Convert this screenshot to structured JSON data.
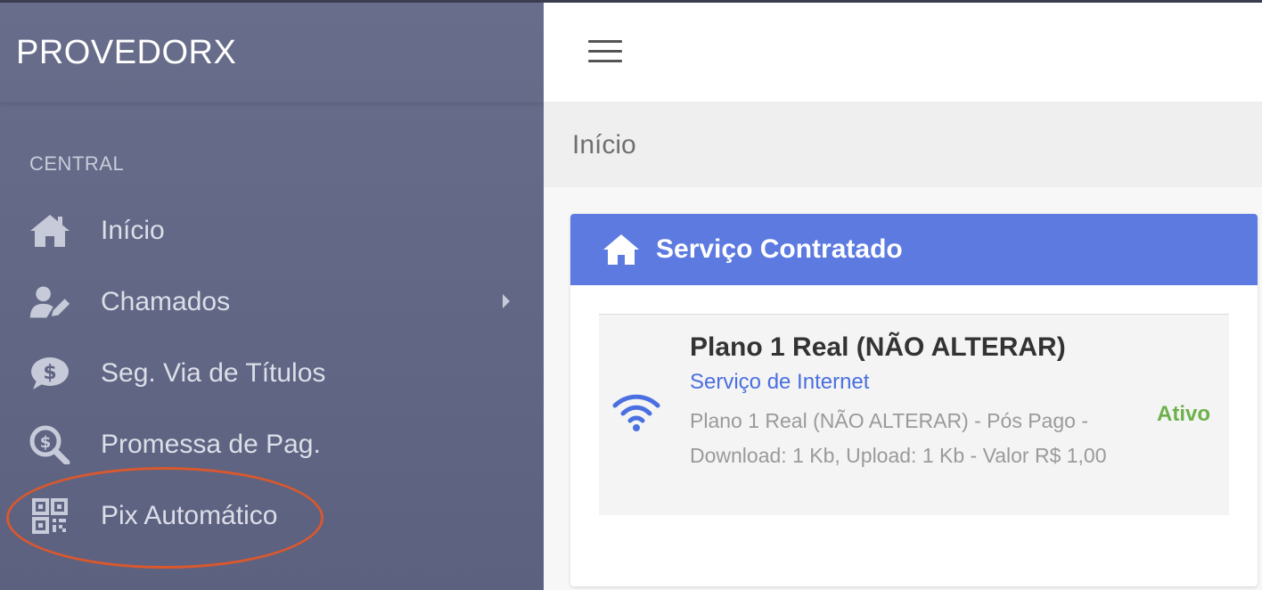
{
  "sidebar": {
    "brand": "PROVEDORX",
    "section_label": "CENTRAL",
    "items": [
      {
        "label": "Início",
        "icon": "home-icon"
      },
      {
        "label": "Chamados",
        "icon": "user-edit-icon",
        "has_submenu": true
      },
      {
        "label": "Seg. Via de Títulos",
        "icon": "money-chat-icon"
      },
      {
        "label": "Promessa de Pag.",
        "icon": "search-dollar-icon"
      },
      {
        "label": "Pix Automático",
        "icon": "qrcode-icon",
        "highlighted": true
      }
    ]
  },
  "topbar": {
    "menu_icon": "hamburger-icon"
  },
  "breadcrumb": {
    "current": "Início"
  },
  "card": {
    "title": "Serviço Contratado",
    "icon": "home-icon",
    "service": {
      "name": "Plano 1 Real (NÃO ALTERAR)",
      "type": "Serviço de Internet",
      "description": "Plano 1 Real (NÃO ALTERAR) - Pós Pago - Download: 1 Kb, Upload: 1 Kb - Valor R$ 1,00",
      "status": "Ativo",
      "icon": "wifi-icon"
    }
  },
  "colors": {
    "sidebar_bg": "#636885",
    "card_header": "#5c7ae0",
    "link": "#4a6fe0",
    "status_active": "#6cb14a",
    "highlight": "#d9582e"
  }
}
